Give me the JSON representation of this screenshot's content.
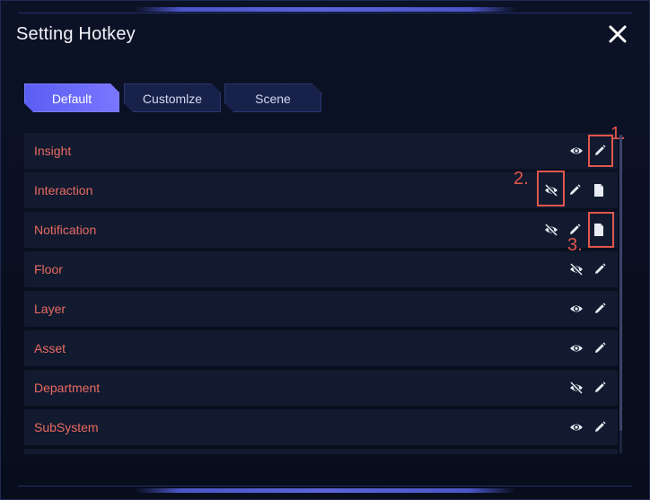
{
  "dialog": {
    "title": "Setting Hotkey",
    "close_icon": "close-icon"
  },
  "tabs": [
    {
      "label": "Default",
      "active": true
    },
    {
      "label": "Customlze",
      "active": false
    },
    {
      "label": "Scene",
      "active": false
    }
  ],
  "rows": [
    {
      "label": "Insight",
      "icons": [
        "eye-icon",
        "pencil-icon"
      ]
    },
    {
      "label": "Interaction",
      "icons": [
        "eye-off-icon",
        "pencil-icon",
        "document-icon"
      ]
    },
    {
      "label": "Notification",
      "icons": [
        "eye-off-icon",
        "pencil-icon",
        "document-icon"
      ]
    },
    {
      "label": "Floor",
      "icons": [
        "eye-off-icon",
        "pencil-icon"
      ]
    },
    {
      "label": "Layer",
      "icons": [
        "eye-icon",
        "pencil-icon"
      ]
    },
    {
      "label": "Asset",
      "icons": [
        "eye-icon",
        "pencil-icon"
      ]
    },
    {
      "label": "Department",
      "icons": [
        "eye-off-icon",
        "pencil-icon"
      ]
    },
    {
      "label": "SubSystem",
      "icons": [
        "eye-icon",
        "pencil-icon"
      ]
    }
  ],
  "annotations": [
    {
      "label": "1."
    },
    {
      "label": "2."
    },
    {
      "label": "3."
    }
  ],
  "colors": {
    "row_label": "#ea6a62",
    "annotation": "#e2564c",
    "active_tab": "#6a6af8",
    "background": "#080d1c"
  }
}
